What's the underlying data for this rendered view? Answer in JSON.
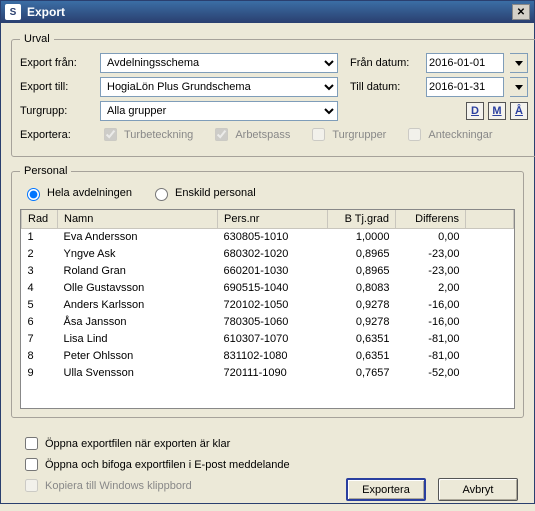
{
  "window": {
    "title": "Export",
    "icon": "S"
  },
  "urval": {
    "legend": "Urval",
    "export_from_label": "Export från:",
    "export_from_value": "Avdelningsschema",
    "export_to_label": "Export till:",
    "export_to_value": "HogiaLön Plus Grundschema",
    "turgrupp_label": "Turgrupp:",
    "turgrupp_value": "Alla grupper",
    "from_date_label": "Från datum:",
    "from_date_value": "2016-01-01",
    "to_date_label": "Till datum:",
    "to_date_value": "2016-01-31",
    "dma": {
      "d": "D",
      "m": "M",
      "a": "Å"
    },
    "exportera_label": "Exportera:",
    "checks": {
      "turbeteckning": "Turbeteckning",
      "arbetspass": "Arbetspass",
      "turgrupper": "Turgrupper",
      "anteckningar": "Anteckningar"
    }
  },
  "personal": {
    "legend": "Personal",
    "radio_all": "Hela avdelningen",
    "radio_single": "Enskild personal",
    "columns": {
      "rad": "Rad",
      "namn": "Namn",
      "pnr": "Pers.nr",
      "tj": "B Tj.grad",
      "diff": "Differens"
    },
    "rows": [
      {
        "rad": "1",
        "namn": "Eva Andersson",
        "pnr": "630805-1010",
        "tj": "1,0000",
        "diff": "0,00"
      },
      {
        "rad": "2",
        "namn": "Yngve Ask",
        "pnr": "680302-1020",
        "tj": "0,8965",
        "diff": "-23,00"
      },
      {
        "rad": "3",
        "namn": "Roland Gran",
        "pnr": "660201-1030",
        "tj": "0,8965",
        "diff": "-23,00"
      },
      {
        "rad": "4",
        "namn": "Olle Gustavsson",
        "pnr": "690515-1040",
        "tj": "0,8083",
        "diff": "2,00"
      },
      {
        "rad": "5",
        "namn": "Anders Karlsson",
        "pnr": "720102-1050",
        "tj": "0,9278",
        "diff": "-16,00"
      },
      {
        "rad": "6",
        "namn": "Åsa Jansson",
        "pnr": "780305-1060",
        "tj": "0,9278",
        "diff": "-16,00"
      },
      {
        "rad": "7",
        "namn": "Lisa Lind",
        "pnr": "610307-1070",
        "tj": "0,6351",
        "diff": "-81,00"
      },
      {
        "rad": "8",
        "namn": "Peter Ohlsson",
        "pnr": "831102-1080",
        "tj": "0,6351",
        "diff": "-81,00"
      },
      {
        "rad": "9",
        "namn": "Ulla Svensson",
        "pnr": "720111-1090",
        "tj": "0,7657",
        "diff": "-52,00"
      }
    ]
  },
  "bottom": {
    "open_after": "Öppna exportfilen när exporten är klar",
    "attach_email": "Öppna och bifoga exportfilen i E-post meddelande",
    "clipboard": "Kopiera till Windows klippbord",
    "export_btn": "Exportera",
    "cancel_btn": "Avbryt"
  }
}
